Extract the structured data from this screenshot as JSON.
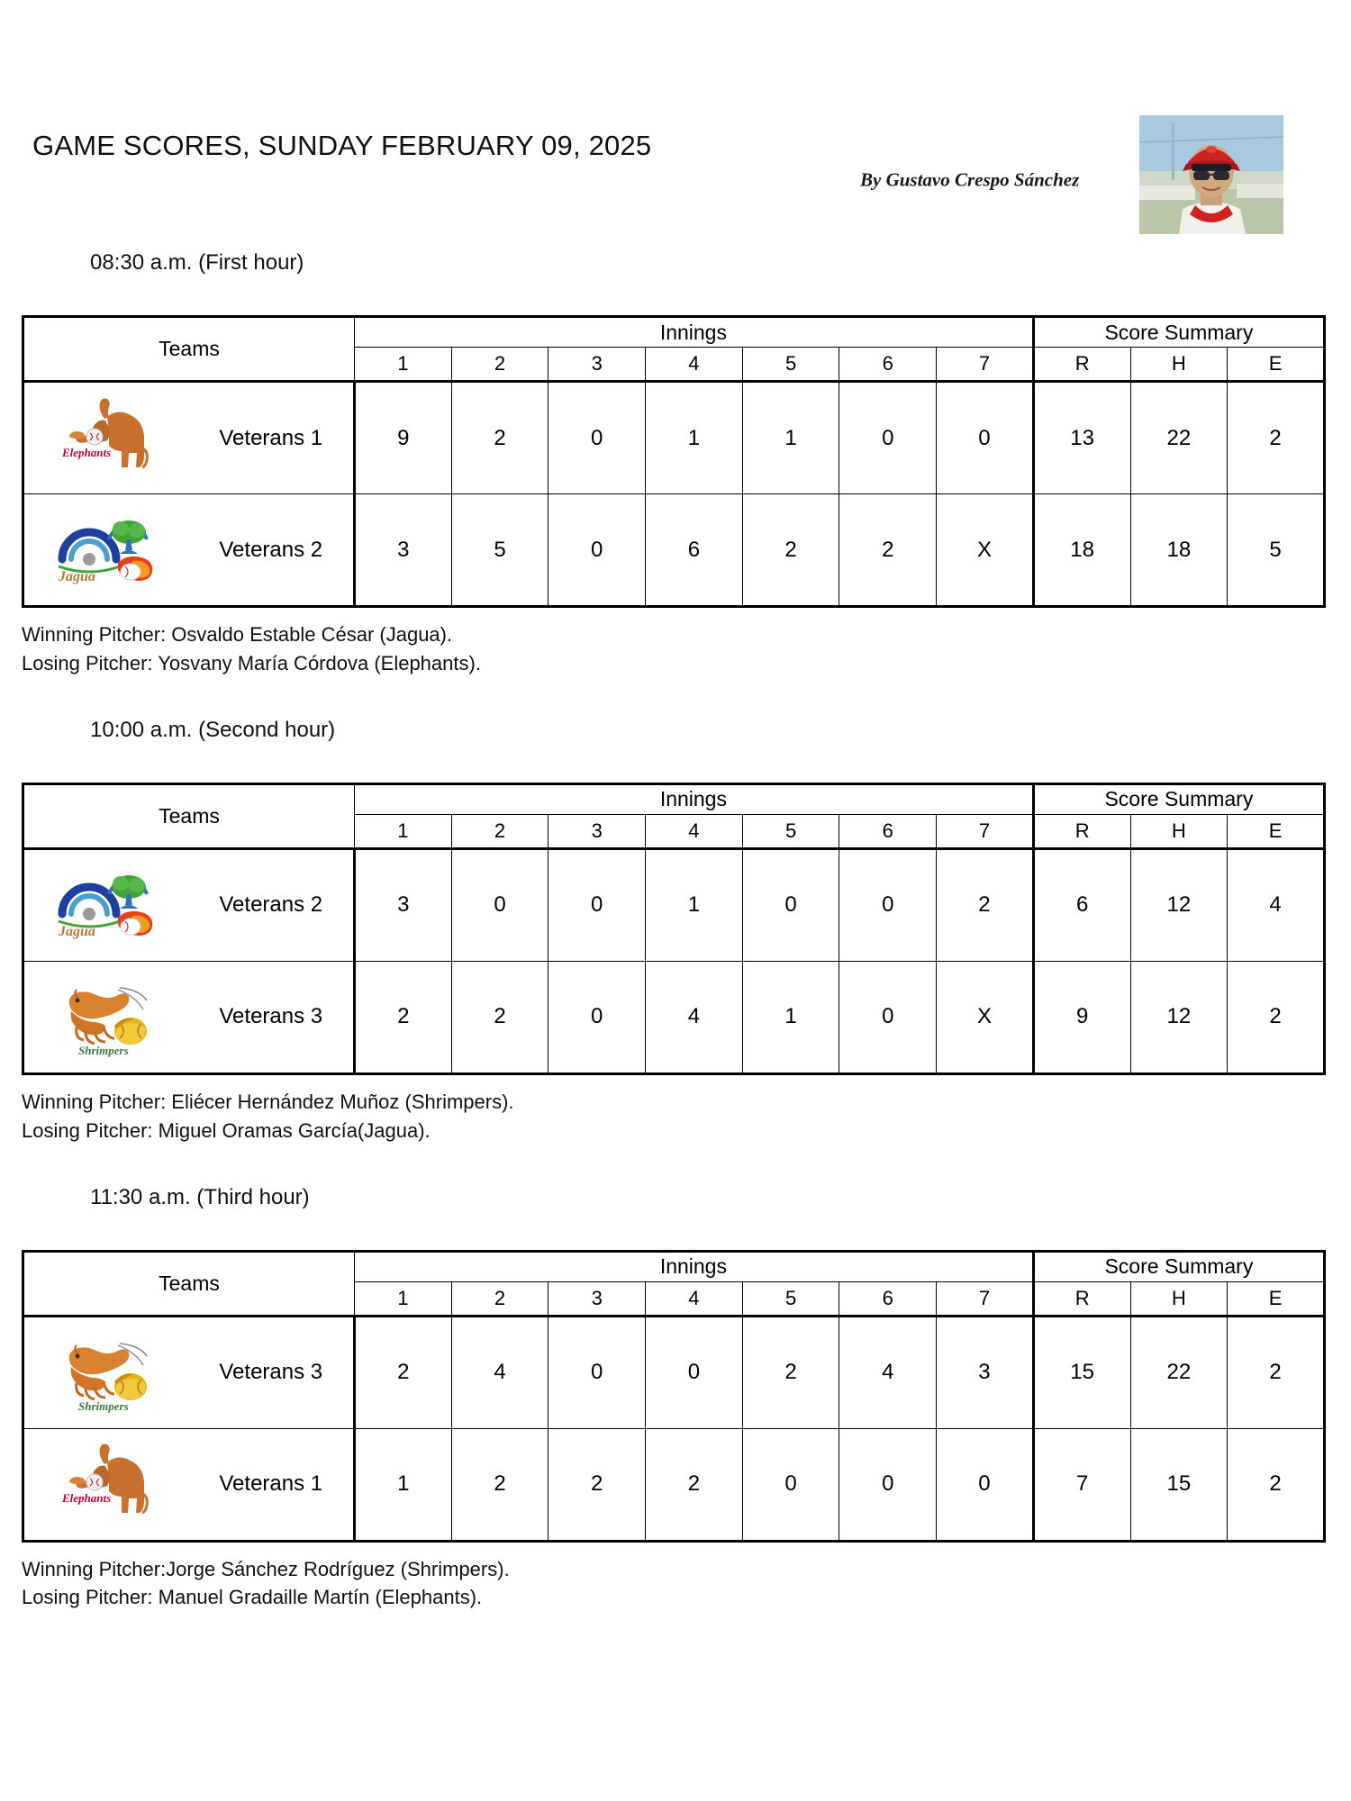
{
  "document": {
    "title": "GAME SCORES, SUNDAY FEBRUARY 09, 2025",
    "byline": "By Gustavo Crespo Sánchez",
    "author_photo_alt": "author-photo"
  },
  "table_headers": {
    "teams": "Teams",
    "innings": "Innings",
    "score_summary": "Score Summary",
    "inning_numbers": [
      "1",
      "2",
      "3",
      "4",
      "5",
      "6",
      "7"
    ],
    "summary_columns": [
      "R",
      "H",
      "E"
    ]
  },
  "labels": {
    "winning_pitcher": "Winning Pitcher:",
    "losing_pitcher": "Losing Pitcher:"
  },
  "colors": {
    "elephant_body": "#c8702e",
    "elephant_text": "#c00030",
    "jagua_arch": "#1f3f9e",
    "jagua_tree": "#3fa535",
    "jagua_flame": "#e8401f",
    "jagua_text": "#b07a3a",
    "shrimp_body": "#d9812f",
    "shrimp_ball": "#e8b51d",
    "shrimpers_text": "#3a7a43",
    "table_border": "#000000",
    "text": "#111111"
  },
  "games": [
    {
      "time_heading": "08:30 a.m. (First hour)",
      "rows": [
        {
          "logo": "elephants-logo",
          "team": "Veterans 1",
          "innings": [
            "9",
            "2",
            "0",
            "1",
            "1",
            "0",
            "0"
          ],
          "r": "13",
          "h": "22",
          "e": "2"
        },
        {
          "logo": "jagua-logo",
          "team": "Veterans 2",
          "innings": [
            "3",
            "5",
            "0",
            "6",
            "2",
            "2",
            "X"
          ],
          "r": "18",
          "h": "18",
          "e": "5"
        }
      ],
      "winning_pitcher": "Winning Pitcher: Osvaldo Estable César (Jagua).",
      "losing_pitcher": "Losing Pitcher: Yosvany María Córdova (Elephants)."
    },
    {
      "time_heading": "10:00 a.m. (Second hour)",
      "rows": [
        {
          "logo": "jagua-logo",
          "team": "Veterans 2",
          "innings": [
            "3",
            "0",
            "0",
            "1",
            "0",
            "0",
            "2"
          ],
          "r": "6",
          "h": "12",
          "e": "4"
        },
        {
          "logo": "shrimpers-logo",
          "team": "Veterans 3",
          "innings": [
            "2",
            "2",
            "0",
            "4",
            "1",
            "0",
            "X"
          ],
          "r": "9",
          "h": "12",
          "e": "2"
        }
      ],
      "winning_pitcher": "Winning Pitcher: Eliécer Hernández Muñoz (Shrimpers).",
      "losing_pitcher": "Losing Pitcher: Miguel Oramas García(Jagua)."
    },
    {
      "time_heading": "11:30 a.m. (Third hour)",
      "rows": [
        {
          "logo": "shrimpers-logo",
          "team": "Veterans 3",
          "innings": [
            "2",
            "4",
            "0",
            "0",
            "2",
            "4",
            "3"
          ],
          "r": "15",
          "h": "22",
          "e": "2"
        },
        {
          "logo": "elephants-logo",
          "team": "Veterans 1",
          "innings": [
            "1",
            "2",
            "2",
            "2",
            "0",
            "0",
            "0"
          ],
          "r": "7",
          "h": "15",
          "e": "2"
        }
      ],
      "winning_pitcher": "Winning Pitcher:Jorge Sánchez Rodríguez (Shrimpers).",
      "losing_pitcher": "Losing Pitcher: Manuel Gradaille Martín (Elephants)."
    }
  ]
}
